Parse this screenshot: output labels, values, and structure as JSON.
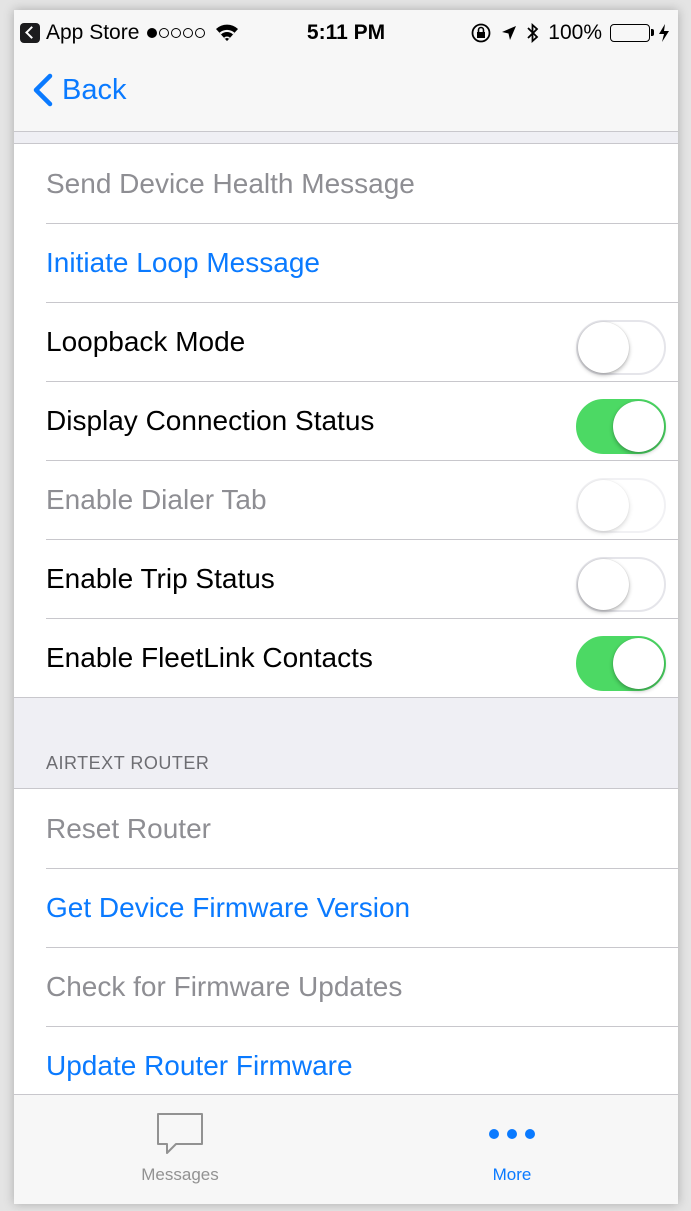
{
  "status_bar": {
    "carrier": "App Store",
    "time": "5:11 PM",
    "battery": "100%",
    "battery_color": "#4cd964"
  },
  "nav": {
    "back_label": "Back",
    "accent": "#0a7aff"
  },
  "rows": [
    {
      "label": "Send Device Health Message",
      "style": "disabled"
    },
    {
      "label": "Initiate Loop Message",
      "style": "link"
    },
    {
      "label": "Loopback Mode",
      "toggle": false
    },
    {
      "label": "Display Connection Status",
      "toggle": true
    },
    {
      "label": "Enable Dialer Tab",
      "toggle": false,
      "style": "disabled"
    },
    {
      "label": "Enable Trip Status",
      "toggle": false
    },
    {
      "label": "Enable FleetLink Contacts",
      "toggle": true
    }
  ],
  "router_section": {
    "header": "AIRTEXT ROUTER",
    "rows": [
      {
        "label": "Reset Router",
        "style": "disabled"
      },
      {
        "label": "Get Device Firmware Version",
        "style": "link"
      },
      {
        "label": "Check for Firmware Updates",
        "style": "disabled"
      },
      {
        "label": "Update Router Firmware",
        "style": "link"
      }
    ]
  },
  "tab_bar": {
    "tabs": [
      {
        "label": "Messages",
        "icon": "speech-bubble-icon"
      },
      {
        "label": "More",
        "icon": "more-dots-icon",
        "selected": true
      }
    ]
  }
}
